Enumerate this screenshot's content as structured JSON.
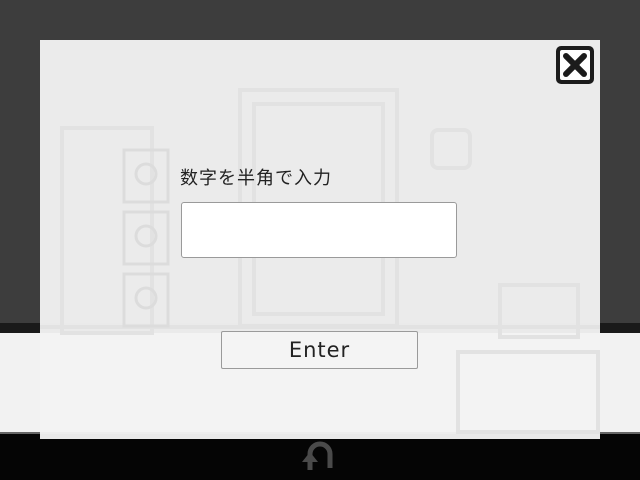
{
  "dialog": {
    "prompt": "数字を半角で入力",
    "input_value": "",
    "input_placeholder": "",
    "enter_label": "Enter"
  },
  "icons": {
    "close": "close-x-icon",
    "back": "u-turn-back-arrow-icon"
  },
  "colors": {
    "background": "#3d3d3d",
    "modal": "#f2f2f2",
    "bottom_bar": "#050505"
  }
}
